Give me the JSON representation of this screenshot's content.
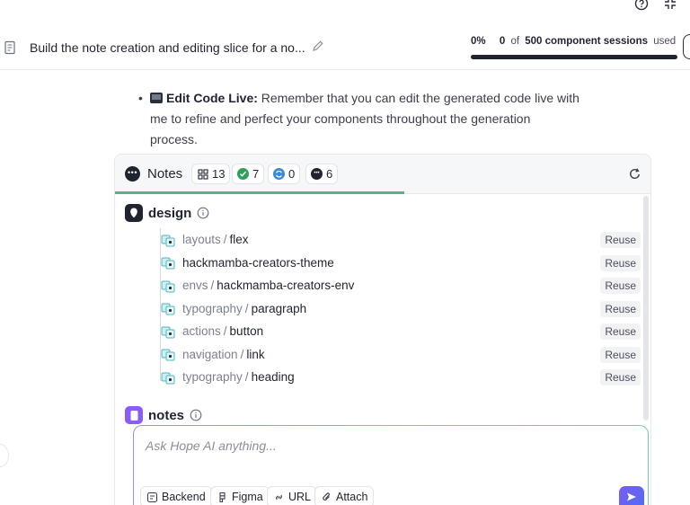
{
  "header": {
    "title": "Build the note creation and editing slice for a no...",
    "usage": {
      "percent": "0%",
      "used": "0",
      "of": "of",
      "limit": "500 component sessions",
      "suffix": "used",
      "progress": 0
    }
  },
  "message": {
    "title": "Edit Code Live:",
    "text1": " Remember that you can edit the generated code live with",
    "text2": "me to refine and perfect your components throughout the generation",
    "text3": "process."
  },
  "panel": {
    "label": "Notes",
    "counts": {
      "components": "13",
      "success": "7",
      "pending": "0",
      "other": "6"
    },
    "sections": [
      {
        "title": "design"
      },
      {
        "title": "notes"
      }
    ],
    "components": [
      {
        "ns": "layouts",
        "sep": "/",
        "name": "flex",
        "action": "Reuse"
      },
      {
        "ns": "",
        "sep": "",
        "name": "hackmamba-creators-theme",
        "action": "Reuse"
      },
      {
        "ns": "envs",
        "sep": "/",
        "name": "hackmamba-creators-env",
        "action": "Reuse"
      },
      {
        "ns": "typography",
        "sep": "/",
        "name": "paragraph",
        "action": "Reuse"
      },
      {
        "ns": "actions",
        "sep": "/",
        "name": "button",
        "action": "Reuse"
      },
      {
        "ns": "navigation",
        "sep": "/",
        "name": "link",
        "action": "Reuse"
      },
      {
        "ns": "typography",
        "sep": "/",
        "name": "heading",
        "action": "Reuse"
      }
    ]
  },
  "composer": {
    "placeholder": "Ask Hope AI anything...",
    "tools": {
      "backend": "Backend",
      "figma": "Figma",
      "url": "URL",
      "attach": "Attach"
    }
  },
  "colors": {
    "accent": "#6c5ce7",
    "success": "#2f9e5b",
    "progress": "#5bb088",
    "pending": "#3b8ad9"
  }
}
